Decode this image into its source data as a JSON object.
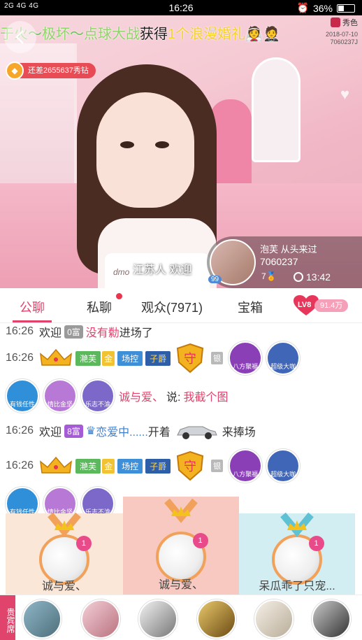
{
  "status_bar": {
    "network": "2G 4G 4G",
    "time": "16:26",
    "battery": "36%"
  },
  "video": {
    "marquee": {
      "part1": "于火",
      "part2": "极坏",
      "part3": "点球大战",
      "part4": "获得",
      "part5": "1个浪漫婚礼"
    },
    "logo_brand": "秀色",
    "logo_date": "2018-07-10",
    "logo_room": "7060237J",
    "diamond_text": "还差2655637秀钻",
    "shirt_text": "dmo",
    "entrance_text": "江苏人 欢迎",
    "entrance_level": "99",
    "host_name": "泡芙 从头来过",
    "host_id": "7060237",
    "host_level": "7",
    "live_time": "13:42"
  },
  "tabs": {
    "public_chat": "公聊",
    "private_chat": "私聊",
    "audience": "观众(7971)",
    "treasure": "宝箱",
    "level": "LV8",
    "level_value": "91.4万"
  },
  "chat": {
    "row1": {
      "time": "16:26",
      "text1": "欢迎",
      "badge": "0富",
      "user": "没有勬",
      "text2": "进场了"
    },
    "row2": {
      "time": "16:26",
      "tag_green": "滟芙",
      "tag_gold": "金",
      "tag_blue": "场控",
      "tag_navy": "子爵",
      "shield": "守",
      "tag_silver": "银",
      "medal1": "八方聚福",
      "medal2": "超级大咖"
    },
    "row3": {
      "medal1": "有钱任性",
      "medal2": "情比金坚",
      "medal3": "乐志不渝",
      "user": "诚与爱、",
      "say": "说:",
      "msg": "我截个图"
    },
    "row4": {
      "time": "16:26",
      "text1": "欢迎",
      "badge": "8富",
      "user": "恋爱中......",
      "text2": "开着",
      "text3": "来捧场"
    },
    "row5": {
      "time": "16:26",
      "tag_green": "滟芙",
      "tag_gold": "金",
      "tag_blue": "场控",
      "tag_navy": "子爵",
      "shield": "守",
      "tag_silver": "银",
      "medal1": "八方聚福",
      "medal2": "超级大咖"
    },
    "row6": {
      "medal1": "有钱任性",
      "medal2": "情比金坚",
      "medal3": "乐志不渝"
    }
  },
  "gifts": [
    {
      "rank": "1",
      "name": "诚与爱、",
      "bg": "#fbe7d8"
    },
    {
      "rank": "1",
      "name": "诚与爱、",
      "bg": "#f7c9c0"
    },
    {
      "rank": "1",
      "name": "呆瓜乖了只宠...",
      "bg": "#d3eef2"
    }
  ],
  "vip": {
    "label": "贵宾席"
  },
  "colors": {
    "accent": "#e0436b",
    "marquee_green": "#6ac259",
    "marquee_yellow": "#f6d12a"
  }
}
